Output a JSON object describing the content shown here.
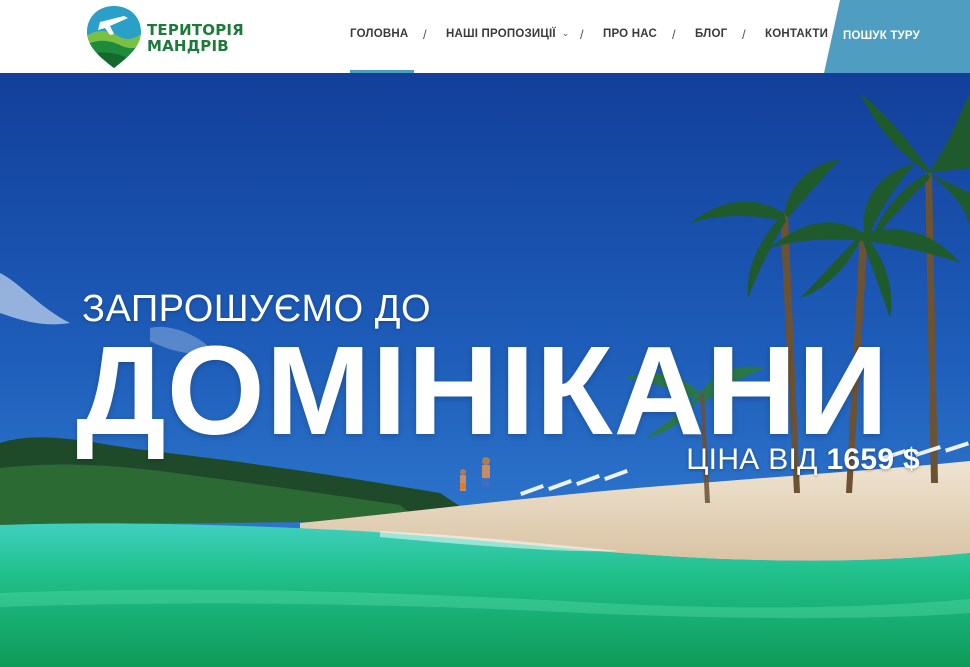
{
  "header": {
    "logo": {
      "line1": "ТЕРИТОРІЯ",
      "line2": "МАНДРІВ"
    },
    "nav": [
      {
        "label": "ГОЛОВНА",
        "active": true
      },
      {
        "label": "НАШІ ПРОПОЗИЦІЇ",
        "has_dropdown": true
      },
      {
        "label": "ПРО НАС"
      },
      {
        "label": "БЛОГ"
      },
      {
        "label": "КОНТАКТИ"
      }
    ],
    "separator": "/",
    "cta_label": "ПОШУК ТУРУ"
  },
  "hero": {
    "subtitle": "ЗАПРОШУЄМО ДО",
    "title": "ДОМІНІКАНИ",
    "price_prefix": "ЦІНА ВІД",
    "price_value": "1659 $"
  },
  "colors": {
    "accent": "#4f9ec1",
    "logo_green": "#1e7a3a",
    "nav_text": "#3b3b3b",
    "sky": "#1f5fb8",
    "sea": "#22c08a"
  },
  "icons": [
    "logo-pin-icon",
    "chevron-down-icon"
  ]
}
